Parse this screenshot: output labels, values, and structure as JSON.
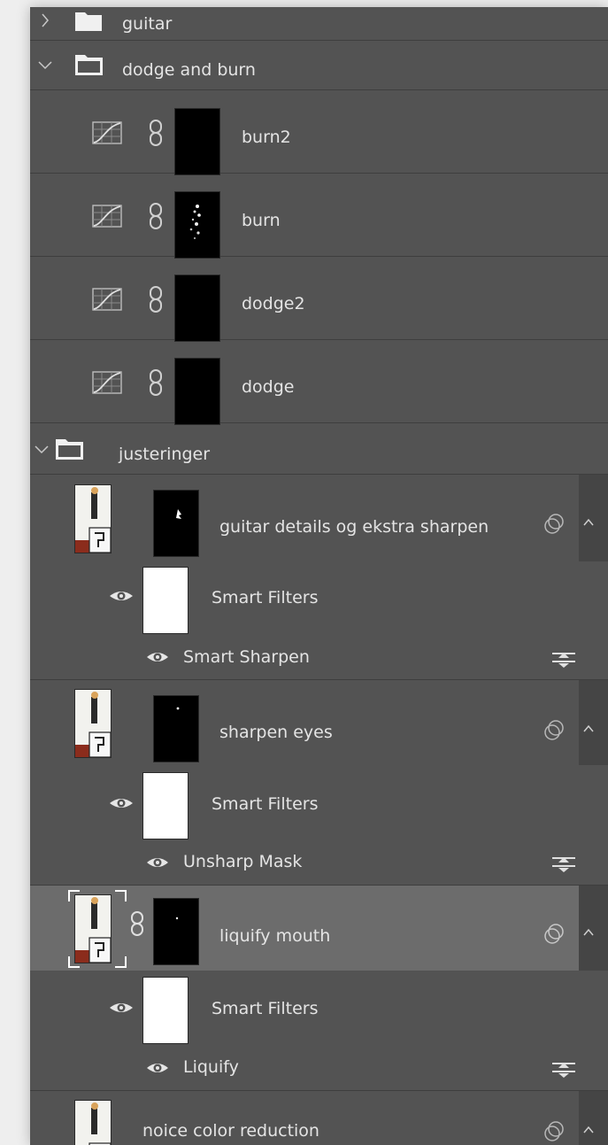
{
  "layers": {
    "guitar_group": {
      "name": "guitar",
      "expanded": false
    },
    "dodge_group": {
      "name": "dodge and burn",
      "expanded": true,
      "children": [
        "burn2",
        "burn",
        "dodge2",
        "dodge"
      ]
    },
    "justeringer_group": {
      "name": "justeringer",
      "expanded": true
    },
    "smart_layers": [
      {
        "name": "guitar details og ekstra sharpen",
        "smart_filters_label": "Smart Filters",
        "filter": "Smart Sharpen",
        "selected": false
      },
      {
        "name": "sharpen eyes",
        "smart_filters_label": "Smart Filters",
        "filter": "Unsharp Mask",
        "selected": false
      },
      {
        "name": "liquify mouth",
        "smart_filters_label": "Smart Filters",
        "filter": "Liquify",
        "selected": true
      }
    ],
    "last_layer": {
      "name": "noice color reduction"
    }
  },
  "colors": {
    "panel_bg": "#535353",
    "selected_bg": "#6c6c6c",
    "divider": "#3e3e3e",
    "text": "#e4e4e4"
  },
  "icons": [
    "chevron-right-icon",
    "chevron-down-icon",
    "folder-icon",
    "curves-icon",
    "link-icon",
    "eye-icon",
    "smart-object-icon",
    "filter-options-icon",
    "blend-overlap-icon",
    "collapse-arrow-icon"
  ]
}
